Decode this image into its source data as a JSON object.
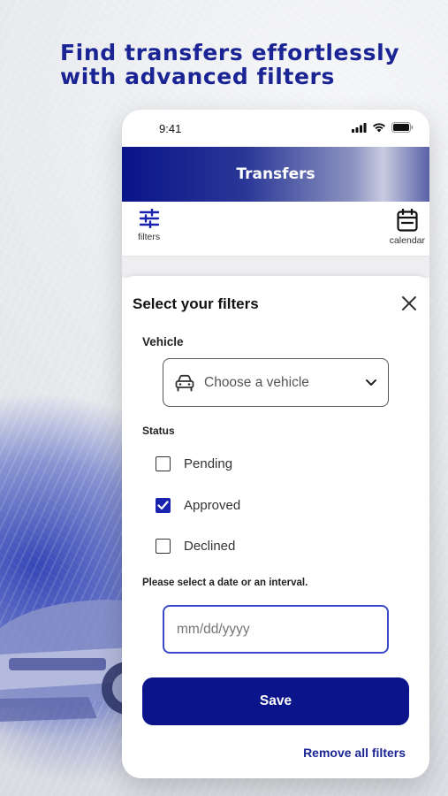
{
  "headline": {
    "line1": "Find transfers effortlessly",
    "line2": "with advanced filters"
  },
  "status_bar": {
    "time": "9:41",
    "icons": [
      "signal-icon",
      "wifi-icon",
      "battery-icon"
    ]
  },
  "app_bar": {
    "title": "Transfers"
  },
  "toolbar": {
    "filters_label": "filters",
    "calendar_label": "calendar"
  },
  "filter_sheet": {
    "title": "Select your filters",
    "vehicle": {
      "label": "Vehicle",
      "placeholder": "Choose a vehicle"
    },
    "status": {
      "label": "Status",
      "options": [
        {
          "label": "Pending",
          "checked": false
        },
        {
          "label": "Approved",
          "checked": true
        },
        {
          "label": "Declined",
          "checked": false
        }
      ]
    },
    "date": {
      "label": "Please select a date or an interval.",
      "placeholder": "mm/dd/yyyy"
    },
    "save_label": "Save",
    "remove_all_label": "Remove all filters"
  },
  "colors": {
    "brand": "#0b148a",
    "headline": "#1a2494",
    "input_focus": "#3947c8"
  }
}
